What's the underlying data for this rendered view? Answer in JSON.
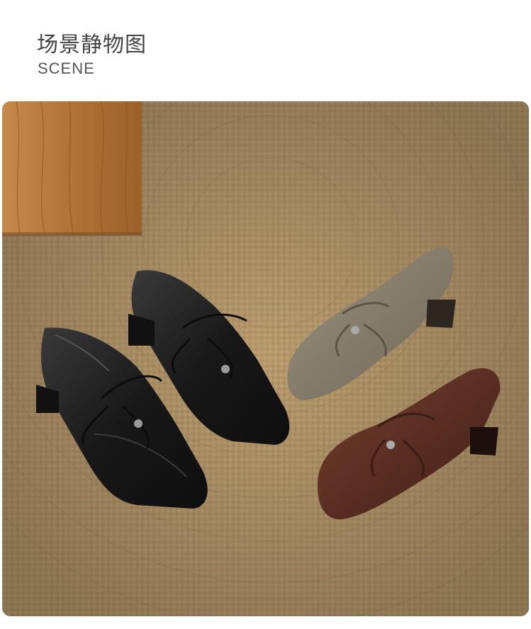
{
  "header": {
    "title_cn": "场景静物图",
    "title_en": "SCENE"
  },
  "photo": {
    "subject": "four-shoes-on-woven-rug",
    "colors": {
      "rug": "#b89a6e",
      "wood": "#b57a3e",
      "black_shoe": "#1c1c1c",
      "taupe_shoe": "#8b8170",
      "brown_shoe": "#5a2e24"
    }
  }
}
